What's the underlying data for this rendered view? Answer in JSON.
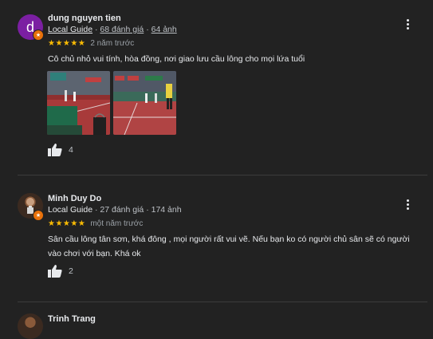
{
  "reviews": [
    {
      "avatar_letter": "d",
      "name": "dung nguyen tien",
      "guide_label": "Local Guide",
      "sep": "·",
      "review_count": "68 đánh giá",
      "photo_count": "64 ảnh",
      "stars": "★★★★★",
      "time": "2 năm trước",
      "text": "Cô chủ nhỏ vui tính, hòa đồng, nơi giao lưu cầu lông cho mọi lứa tuổi",
      "likes": "4"
    },
    {
      "name": "Minh Duy Do",
      "guide_label": "Local Guide",
      "sep": "·",
      "review_count": "27 đánh giá",
      "photo_count": "174 ảnh",
      "stars": "★★★★★",
      "time": "một năm trước",
      "text": "Sân cầu lông tân sơn, khá đông , mọi người rất vui vẽ. Nếu bạn ko có người chủ sân sẽ có người vào chơi với bạn. Khá ok",
      "likes": "2"
    },
    {
      "name": "Trinh Trang"
    }
  ],
  "colors": {
    "background": "#222222",
    "star": "#fbbc04",
    "avatar_purple": "#7b1fa2",
    "badge": "#e8710a"
  },
  "icons": {
    "like": "thumbs-up-icon",
    "more": "more-vert-icon",
    "badge": "local-guide-star-icon"
  }
}
